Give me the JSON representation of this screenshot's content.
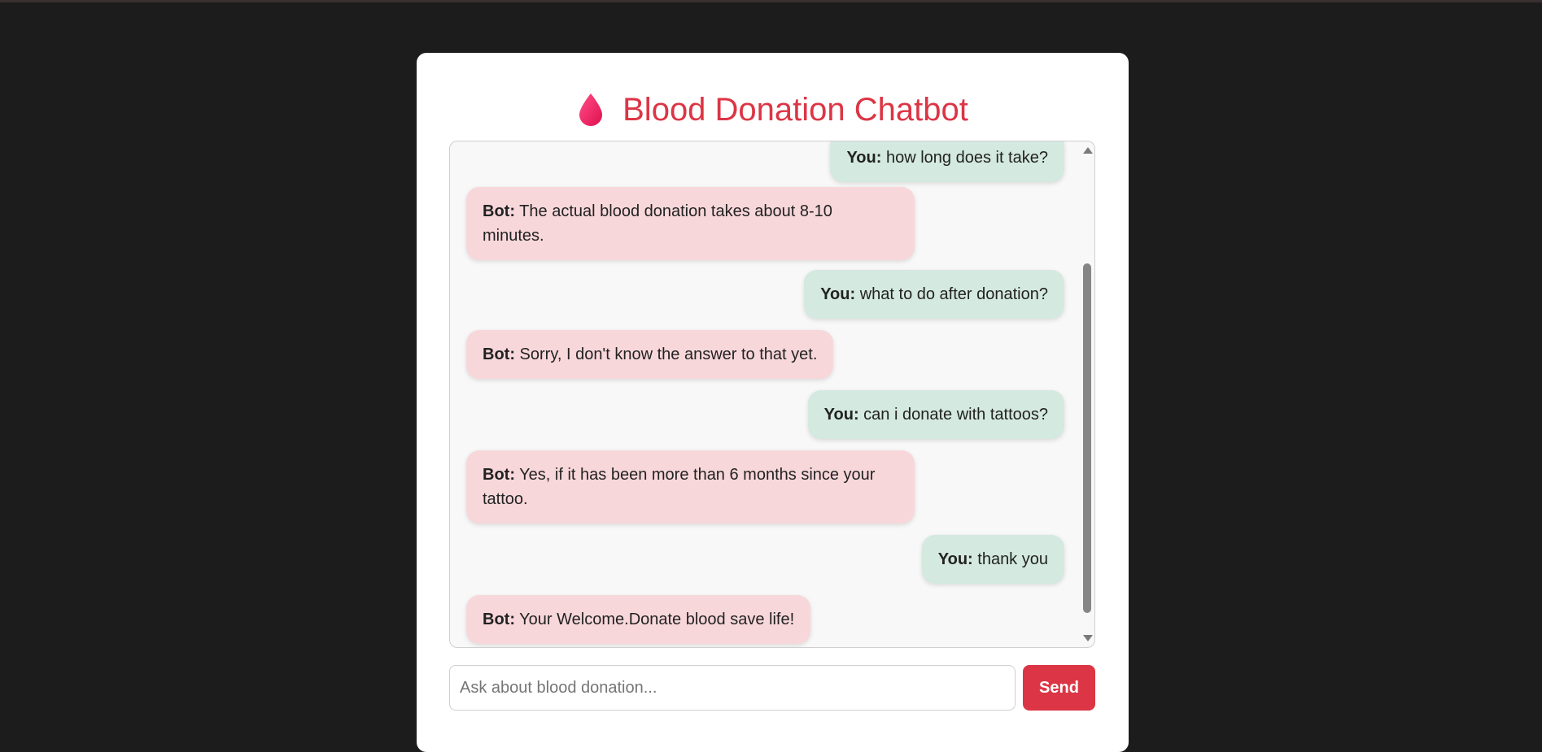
{
  "app": {
    "title": "Blood Donation Chatbot",
    "icon": "blood-drop-icon",
    "accent_color": "#dc3545"
  },
  "messages": [
    {
      "sender": "user",
      "speaker": "You:",
      "text": " how long does it take?"
    },
    {
      "sender": "bot",
      "speaker": "Bot:",
      "text": " The actual blood donation takes about 8-10 minutes."
    },
    {
      "sender": "user",
      "speaker": "You:",
      "text": " what to do after donation?"
    },
    {
      "sender": "bot",
      "speaker": "Bot:",
      "text": " Sorry, I don't know the answer to that yet."
    },
    {
      "sender": "user",
      "speaker": "You:",
      "text": " can i donate with tattoos?"
    },
    {
      "sender": "bot",
      "speaker": "Bot:",
      "text": " Yes, if it has been more than 6 months since your tattoo."
    },
    {
      "sender": "user",
      "speaker": "You:",
      "text": " thank you"
    },
    {
      "sender": "bot",
      "speaker": "Bot:",
      "text": " Your Welcome.Donate blood save life!"
    }
  ],
  "colors": {
    "bot_bubble": "#f8d7da",
    "user_bubble": "#d4e9e0"
  },
  "input": {
    "placeholder": "Ask about blood donation...",
    "value": ""
  },
  "send_button": {
    "label": "Send"
  }
}
